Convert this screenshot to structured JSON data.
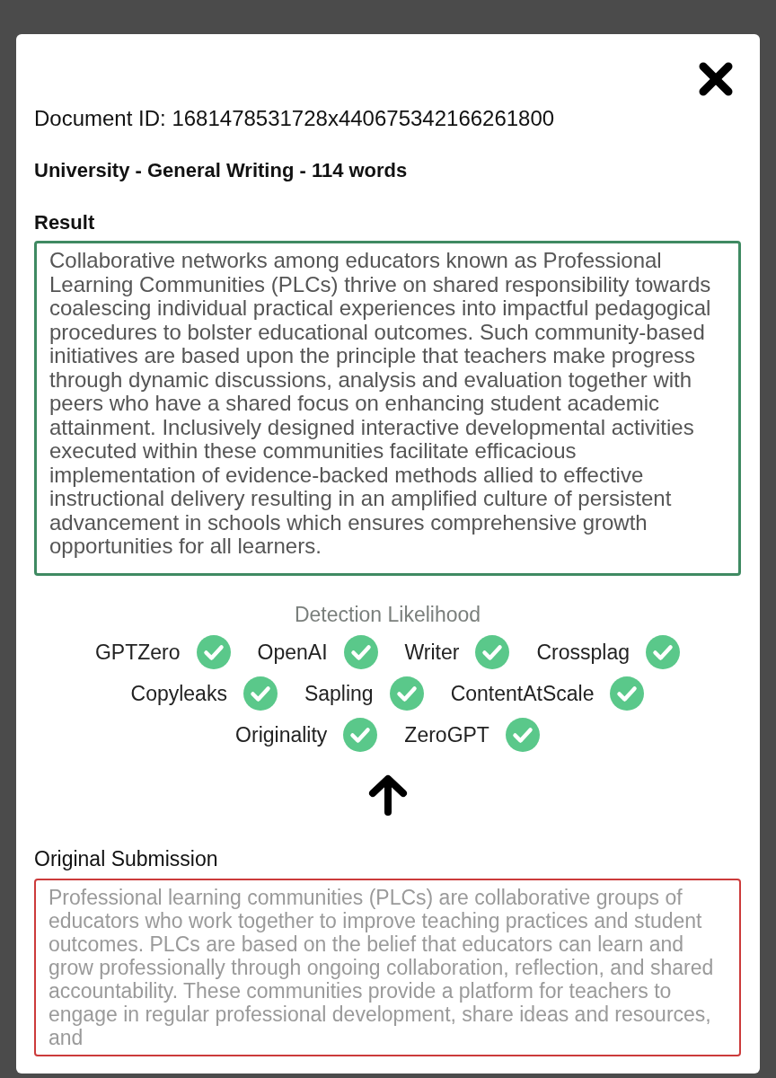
{
  "document_id": "Document ID: 1681478531728x440675342166261800",
  "summary": "University - General Writing - 114 words",
  "result": {
    "label": "Result",
    "text": "Collaborative networks among educators known as Professional Learning Communities (PLCs) thrive on shared responsibility towards coalescing individual practical experiences into impactful pedagogical procedures to bolster educational outcomes. Such community-based initiatives are based upon the principle that teachers make progress through dynamic discussions, analysis and evaluation together with peers who have a shared focus on enhancing student academic attainment. Inclusively designed interactive developmental activities executed within these communities facilitate efficacious implementation of evidence-backed methods allied to effective instructional delivery resulting in an amplified culture of persistent advancement in schools which ensures comprehensive growth opportunities for all learners."
  },
  "detection": {
    "title": "Detection Likelihood",
    "detectors": [
      {
        "name": "GPTZero",
        "passed": true
      },
      {
        "name": "OpenAI",
        "passed": true
      },
      {
        "name": "Writer",
        "passed": true
      },
      {
        "name": "Crossplag",
        "passed": true
      },
      {
        "name": "Copyleaks",
        "passed": true
      },
      {
        "name": "Sapling",
        "passed": true
      },
      {
        "name": "ContentAtScale",
        "passed": true
      },
      {
        "name": "Originality",
        "passed": true
      },
      {
        "name": "ZeroGPT",
        "passed": true
      }
    ]
  },
  "original": {
    "label": "Original Submission",
    "text": "Professional learning communities (PLCs) are collaborative groups of educators who work together to improve teaching practices and student outcomes. PLCs are based on the belief that educators can learn and grow professionally through ongoing collaboration, reflection, and shared accountability. These communities provide a platform for teachers to engage in regular professional development, share ideas and resources, and"
  }
}
